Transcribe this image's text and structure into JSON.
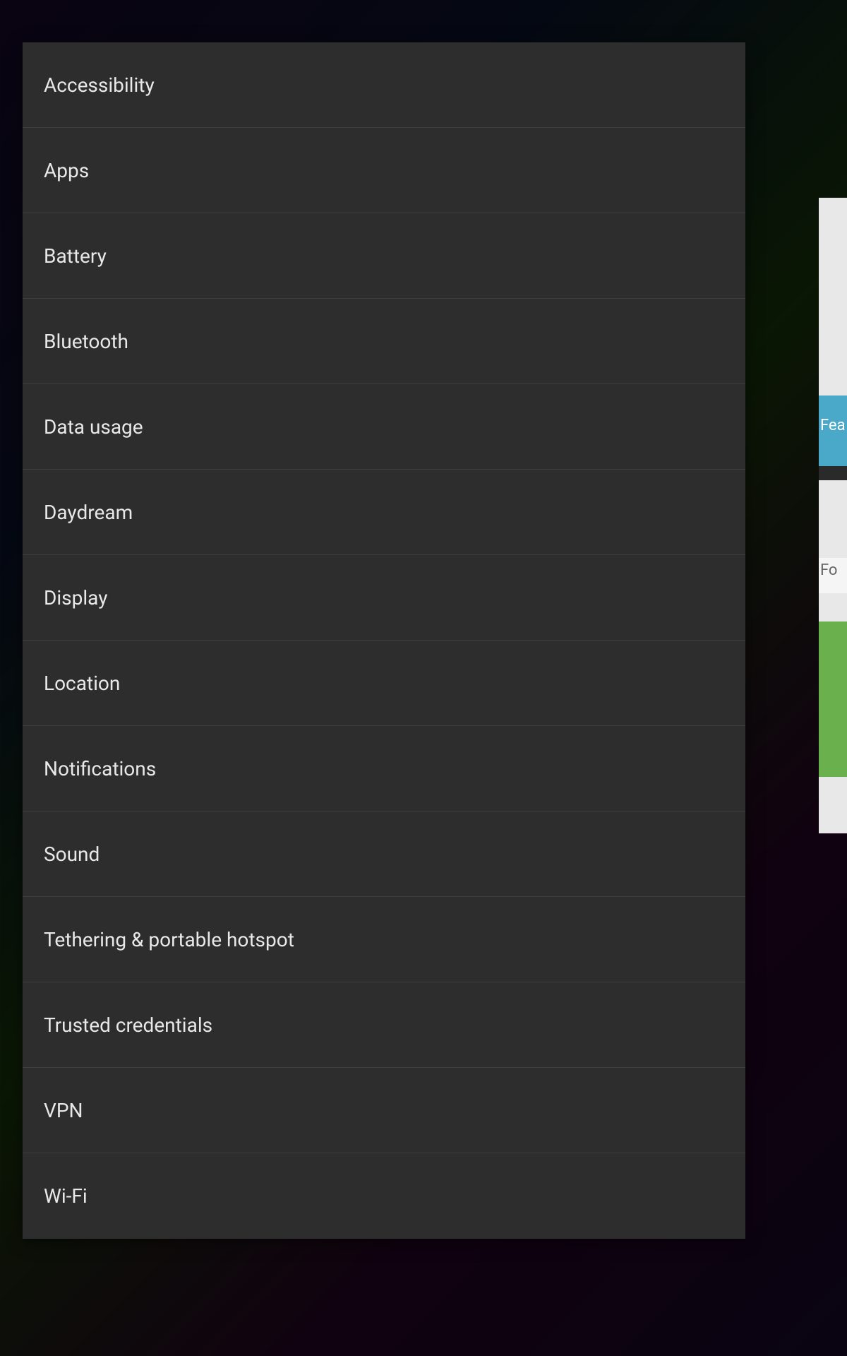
{
  "menu": {
    "items": [
      {
        "label": "Accessibility",
        "name": "menu-item-accessibility"
      },
      {
        "label": "Apps",
        "name": "menu-item-apps"
      },
      {
        "label": "Battery",
        "name": "menu-item-battery"
      },
      {
        "label": "Bluetooth",
        "name": "menu-item-bluetooth"
      },
      {
        "label": "Data usage",
        "name": "menu-item-data-usage"
      },
      {
        "label": "Daydream",
        "name": "menu-item-daydream"
      },
      {
        "label": "Display",
        "name": "menu-item-display"
      },
      {
        "label": "Location",
        "name": "menu-item-location"
      },
      {
        "label": "Notifications",
        "name": "menu-item-notifications"
      },
      {
        "label": "Sound",
        "name": "menu-item-sound"
      },
      {
        "label": "Tethering & portable hotspot",
        "name": "menu-item-tethering"
      },
      {
        "label": "Trusted credentials",
        "name": "menu-item-trusted-credentials"
      },
      {
        "label": "VPN",
        "name": "menu-item-vpn"
      },
      {
        "label": "Wi-Fi",
        "name": "menu-item-wifi"
      }
    ]
  },
  "background": {
    "teal_text": "Fea",
    "white_text": "Fo"
  }
}
